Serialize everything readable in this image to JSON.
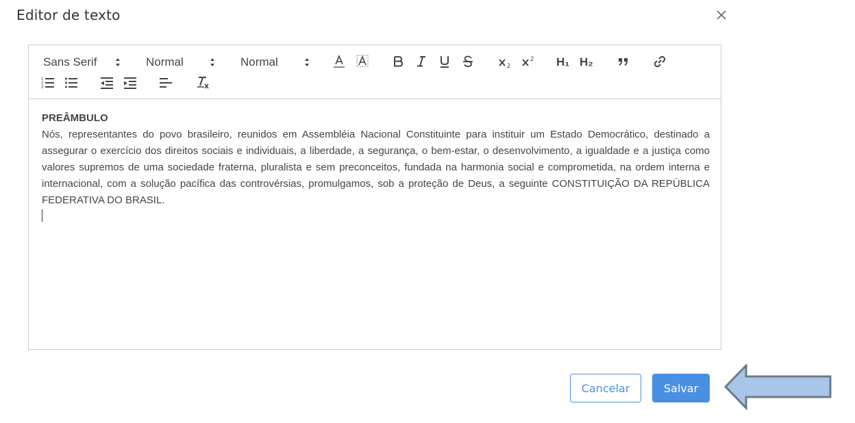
{
  "dialog": {
    "title": "Editor de texto"
  },
  "toolbar": {
    "font_picker": "Sans Serif",
    "size_picker": "Normal",
    "header_picker": "Normal",
    "h1": "H₁",
    "h2": "H₂"
  },
  "content": {
    "heading": "PREÂMBULO",
    "paragraph": "Nós, representantes do povo brasileiro, reunidos em Assembléia Nacional Constituinte para instituir um Estado Democrático, destinado a assegurar o exercício dos direitos sociais e individuais, a liberdade, a segurança, o bem-estar, o desenvolvimento, a igualdade e a justiça como valores supremos de uma sociedade fraterna, pluralista e sem preconceitos, fundada na harmonia social e comprometida, na ordem interna e internacional, com a solução pacífica das controvérsias, promulgamos, sob a proteção de Deus, a seguinte CONSTITUIÇÃO DA REPÚBLICA FEDERATIVA DO BRASIL."
  },
  "footer": {
    "cancel_label": "Cancelar",
    "save_label": "Salvar"
  },
  "icons": {
    "close": "close-icon",
    "text_color": "text-color-icon",
    "background_color": "background-color-icon",
    "bold": "bold-icon",
    "italic": "italic-icon",
    "underline": "underline-icon",
    "strike": "strikethrough-icon",
    "subscript": "subscript-icon",
    "superscript": "superscript-icon",
    "blockquote": "blockquote-icon",
    "link": "link-icon",
    "ordered_list": "ordered-list-icon",
    "bullet_list": "bullet-list-icon",
    "outdent": "outdent-icon",
    "indent": "indent-icon",
    "align": "align-left-icon",
    "clean": "clear-format-icon",
    "arrow_annotation": "arrow-annotation-icon"
  },
  "colors": {
    "accent": "#4a90e2",
    "annotation_arrow_fill": "#a9c6e8",
    "annotation_arrow_stroke": "#6b7a8a"
  }
}
